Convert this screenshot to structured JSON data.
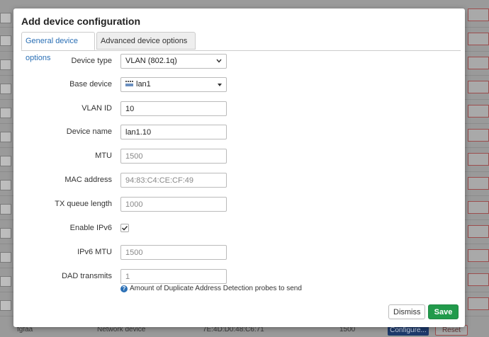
{
  "background": {
    "bottom_row": {
      "name": "fgfaa",
      "type": "Network device",
      "mac": "7E:4D:D0:48:C6:71",
      "mtu": "1500",
      "configure_label": "Configure...",
      "reset_label": "Reset"
    }
  },
  "modal": {
    "title": "Add device configuration",
    "tabs": [
      {
        "label": "General device options"
      },
      {
        "label": "Advanced device options"
      }
    ],
    "fields": {
      "device_type": {
        "label": "Device type",
        "value": "VLAN (802.1q)"
      },
      "base_device": {
        "label": "Base device",
        "value": "lan1"
      },
      "vlan_id": {
        "label": "VLAN ID",
        "value": "10"
      },
      "device_name": {
        "label": "Device name",
        "value": "lan1.10"
      },
      "mtu": {
        "label": "MTU",
        "placeholder": "1500"
      },
      "mac_address": {
        "label": "MAC address",
        "placeholder": "94:83:C4:CE:CF:49"
      },
      "tx_queue_length": {
        "label": "TX queue length",
        "placeholder": "1000"
      },
      "enable_ipv6": {
        "label": "Enable IPv6",
        "checked": true
      },
      "ipv6_mtu": {
        "label": "IPv6 MTU",
        "placeholder": "1500"
      },
      "dad_transmits": {
        "label": "DAD transmits",
        "placeholder": "1",
        "help": "Amount of Duplicate Address Detection probes to send"
      }
    },
    "buttons": {
      "dismiss": "Dismiss",
      "save": "Save"
    }
  }
}
